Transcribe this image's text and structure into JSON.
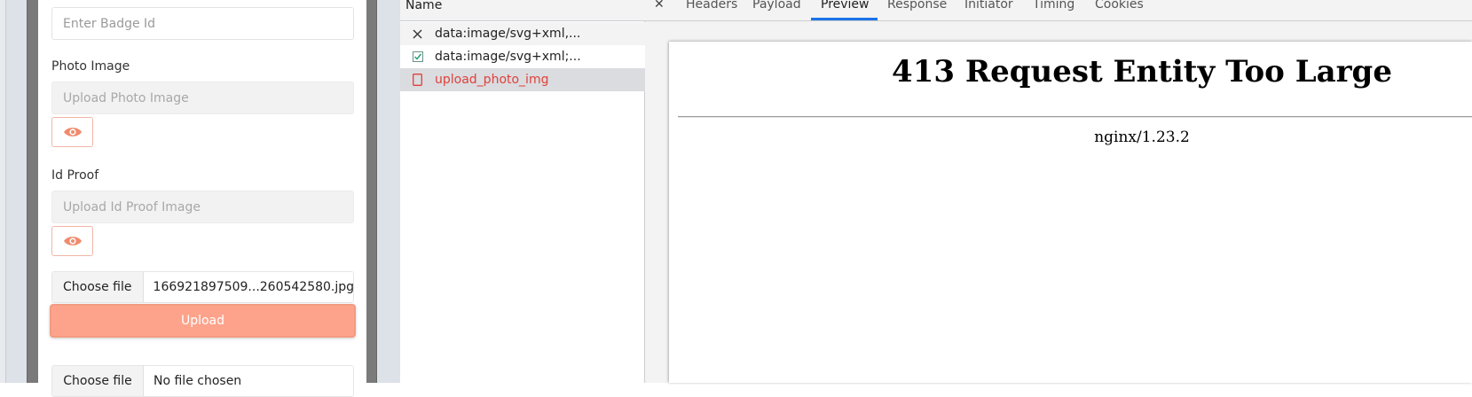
{
  "app": {
    "badge_placeholder": "Enter Badge Id",
    "photo_label": "Photo Image",
    "photo_placeholder": "Upload Photo Image",
    "idproof_label": "Id Proof",
    "idproof_placeholder": "Upload Id Proof Image",
    "file1": {
      "button": "Choose file",
      "name": "166921897509...260542580.jpg"
    },
    "upload_label": "Upload",
    "file2": {
      "button": "Choose file",
      "name": "No file chosen"
    },
    "colors": {
      "accent": "#fda38b",
      "eye": "#f08a6c"
    }
  },
  "devtools": {
    "list_header": "Name",
    "requests": [
      {
        "icon": "close-icon",
        "name": "data:image/svg+xml,..."
      },
      {
        "icon": "checkbox-icon",
        "name": "data:image/svg+xml;..."
      },
      {
        "icon": "document-icon",
        "name": "upload_photo_img",
        "status": "error"
      }
    ],
    "tabs": [
      "Headers",
      "Payload",
      "Preview",
      "Response",
      "Initiator",
      "Timing",
      "Cookies"
    ],
    "active_tab": "Preview",
    "colors": {
      "active_tab_underline": "#1a73e8",
      "error_text": "#e0413a"
    }
  },
  "preview": {
    "title": "413 Request Entity Too Large",
    "server": "nginx/1.23.2"
  }
}
